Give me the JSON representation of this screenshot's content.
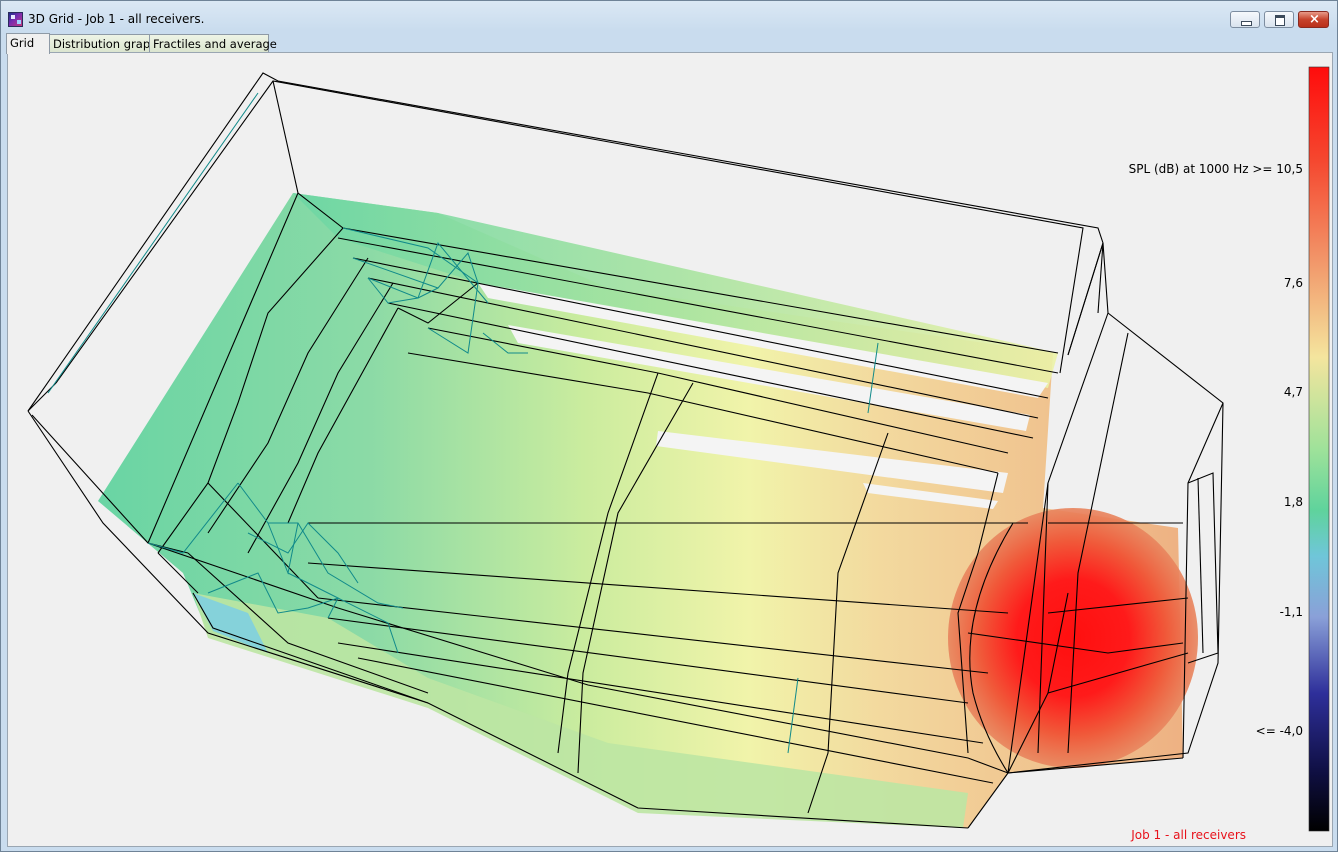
{
  "window": {
    "title": "3D Grid - Job 1 - all receivers."
  },
  "tabs": [
    {
      "label": "Grid",
      "active": true
    },
    {
      "label": "Distribution graph",
      "active": false
    },
    {
      "label": "Fractiles and average",
      "active": false
    }
  ],
  "legend": {
    "title": "SPL (dB)  at 1000 Hz >= 10,5",
    "ticks": [
      "7,6",
      "4,7",
      "1,8",
      "-1,1",
      "<= -4,0"
    ]
  },
  "footer_label": "Job 1 - all receivers",
  "colors": {
    "accent_label": "#e8121b",
    "high": "#ff1a1a",
    "mid": "#f5f0a0",
    "low_green": "#5ccf9a",
    "low_blue": "#2e2f9a",
    "lowest": "#000000"
  },
  "icons": [
    "app-icon",
    "minimize-icon",
    "maximize-icon",
    "close-icon"
  ]
}
